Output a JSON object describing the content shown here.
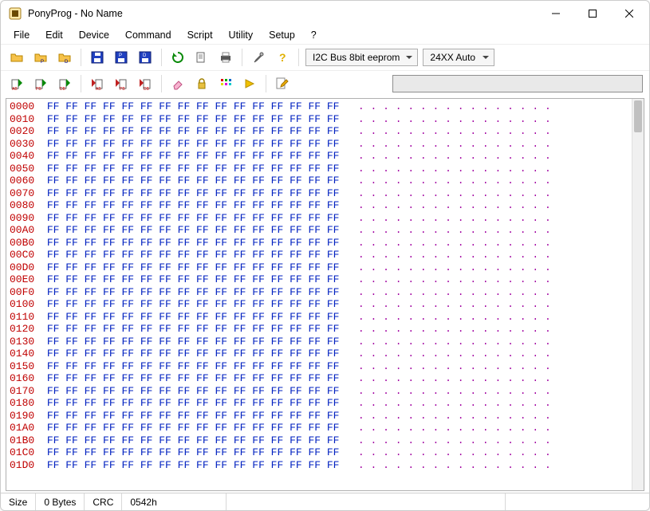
{
  "window": {
    "title": "PonyProg - No Name"
  },
  "menu": {
    "items": [
      "File",
      "Edit",
      "Device",
      "Command",
      "Script",
      "Utility",
      "Setup",
      "?"
    ]
  },
  "combos": {
    "bus": {
      "value": "I2C Bus 8bit eeprom"
    },
    "device": {
      "value": "24XX Auto"
    },
    "address": {
      "value": ""
    }
  },
  "status": {
    "size_label": "Size",
    "size_value": "0 Bytes",
    "crc_label": "CRC",
    "crc_value": "0542h"
  },
  "hex": {
    "rows": 30,
    "cols": 16,
    "start": 0,
    "fill_byte": "FF",
    "ascii_fill": "."
  }
}
